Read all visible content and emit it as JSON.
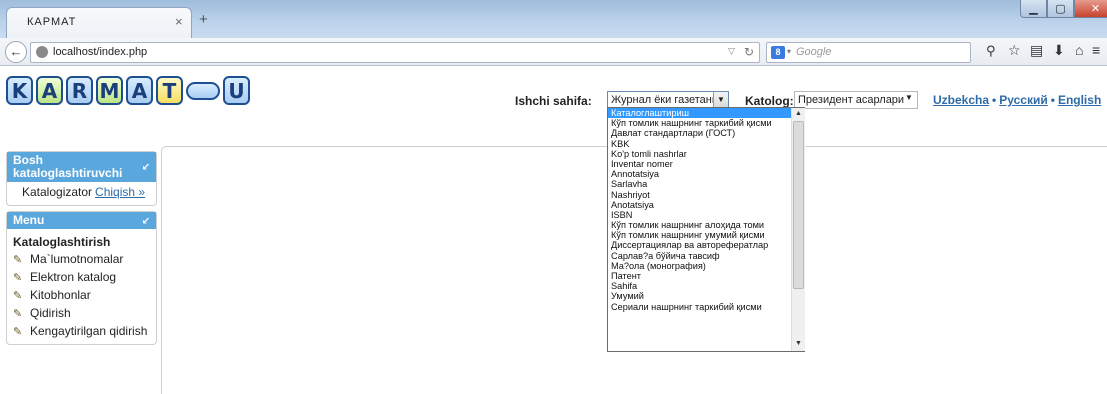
{
  "browser": {
    "tab_title": "КАРМАТ",
    "tab_close": "×",
    "new_tab": "+",
    "url": "localhost/index.php",
    "search_engine": "8",
    "search_placeholder": "Google"
  },
  "logo": {
    "letters": [
      "K",
      "A",
      "R",
      "M",
      "A",
      "T",
      "U"
    ]
  },
  "header": {
    "ishchi_label": "Ishchi sahifa:",
    "ishchi_value": "Журнал ёки газетанин",
    "katolog_label": "Katolog:",
    "katolog_value": "Президент асарлари",
    "languages": [
      "Uzbekcha",
      "Русский",
      "English"
    ]
  },
  "sidebar": {
    "box1": {
      "title": "Bosh kataloglashtiruvchi",
      "user": "Katalogizator",
      "logout": "Chiqish »"
    },
    "box2": {
      "title": "Menu",
      "heading": "Kataloglashtirish",
      "items": [
        "Ma`lumotnomalar",
        "Elektron katalog",
        "Kitobhonlar",
        "Qidirish",
        "Kengaytirilgan qidirish"
      ]
    }
  },
  "dropdown": {
    "options": [
      "Каталоглаштириш",
      "Кўп томлик нашрнинг таркибий қисми",
      "Давлат стандартлари (ГОСТ)",
      "KBK",
      "Ko'p tomli nashrlar",
      "Inventar nomer",
      "Annotatsiya",
      "Sarlavha",
      "Nashriyot",
      "Anotatsiya",
      "ISBN",
      "Кўп томлик нашрнинг алоҳида томи",
      "Кўп томлик нашрнинг умумий қисми",
      "Диссертациялар ва авторефератлар",
      "Сарлав?а бўйича тавсиф",
      "Ма?ола (монография)",
      "Патент",
      "Sahifa",
      "Умумий",
      "Сериали нашрнинг таркибий қисми"
    ],
    "selected_index": 0
  }
}
